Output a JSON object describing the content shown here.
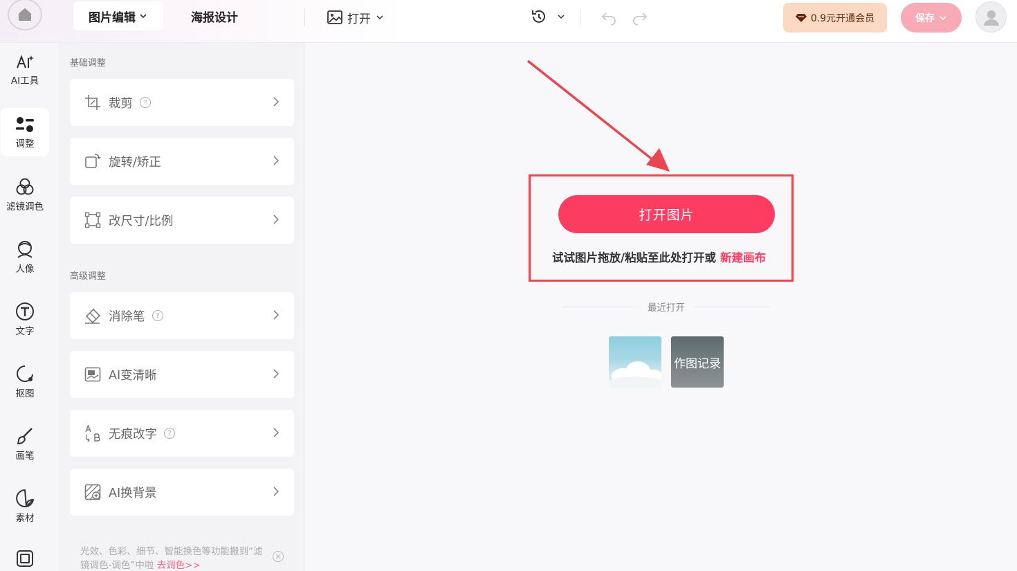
{
  "header": {
    "mode_tabs": [
      {
        "label": "图片编辑"
      },
      {
        "label": "海报设计"
      }
    ],
    "open_menu_label": "打开",
    "vip_button_label": "0.9元开通会员",
    "save_button_label": "保存"
  },
  "rail": {
    "items": [
      {
        "label": "AI工具",
        "icon": "ai-tools-icon"
      },
      {
        "label": "调整",
        "icon": "adjust-icon",
        "active": true
      },
      {
        "label": "滤镜调色",
        "icon": "filter-icon"
      },
      {
        "label": "人像",
        "icon": "portrait-icon"
      },
      {
        "label": "文字",
        "icon": "text-icon"
      },
      {
        "label": "抠图",
        "icon": "cutout-icon"
      },
      {
        "label": "画笔",
        "icon": "brush-icon"
      },
      {
        "label": "素材",
        "icon": "sticker-icon"
      }
    ]
  },
  "panel": {
    "basic_title": "基础调整",
    "advanced_title": "高级调整",
    "basic_tools": [
      {
        "label": "裁剪",
        "help": true
      },
      {
        "label": "旋转/矫正",
        "help": false
      },
      {
        "label": "改尺寸/比例",
        "help": false
      }
    ],
    "advanced_tools": [
      {
        "label": "消除笔",
        "help": true
      },
      {
        "label": "AI变清晰",
        "help": false
      },
      {
        "label": "无痕改字",
        "help": true
      },
      {
        "label": "AI换背景",
        "help": false
      }
    ],
    "tip_text": "光效、色彩、细节、智能换色等功能搬到“滤镜调色-调色”中啦",
    "tip_link": "去调色>>"
  },
  "canvas": {
    "open_button_label": "打开图片",
    "drop_hint": "试试图片拖放/粘贴至此处打开或",
    "new_canvas_link": "新建画布",
    "recent_label": "最近打开",
    "record_thumb_label": "作图记录"
  },
  "colors": {
    "accent": "#fd3c61",
    "highlight_border": "#e8474f",
    "vip_bg": "#fcd9c2",
    "save_bg": "#f9aab7"
  }
}
